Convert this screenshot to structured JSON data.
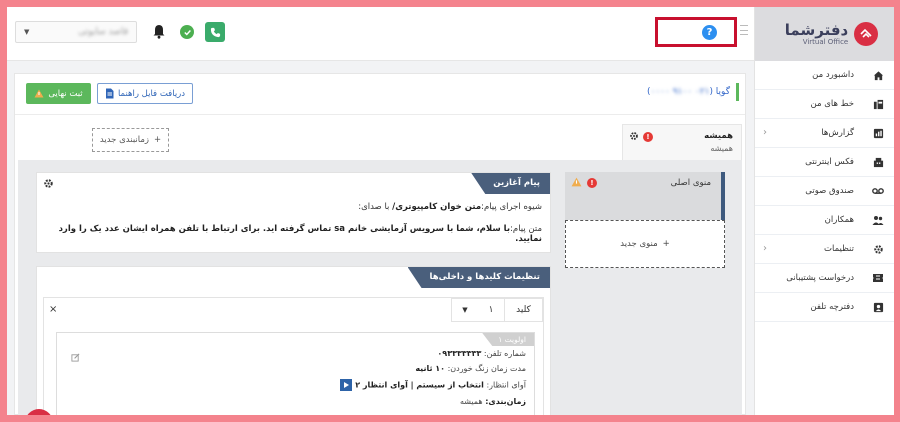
{
  "app": {
    "logo_name": "دفترشما",
    "logo_sub": "Virtual Office",
    "brand_color": "#d92f44"
  },
  "sidebar": {
    "items": [
      {
        "label": "داشبورد من",
        "icon": "home-icon",
        "has_children": false
      },
      {
        "label": "خط های من",
        "icon": "phone-lines-icon",
        "has_children": false
      },
      {
        "label": "گزارش‌ها",
        "icon": "reports-icon",
        "has_children": true
      },
      {
        "label": "فکس اینترنتی",
        "icon": "fax-icon",
        "has_children": false
      },
      {
        "label": "صندوق صوتی",
        "icon": "voicemail-icon",
        "has_children": false
      },
      {
        "label": "همکاران",
        "icon": "users-icon",
        "has_children": false
      },
      {
        "label": "تنظیمات",
        "icon": "gear-icon",
        "has_children": true
      },
      {
        "label": "درخواست پشتیبانی",
        "icon": "ticket-icon",
        "has_children": false
      },
      {
        "label": "دفترچه تلفن",
        "icon": "contacts-icon",
        "has_children": false
      }
    ]
  },
  "topbar": {
    "help_icon": "question-icon",
    "help_symbol": "?",
    "company_select": "قاصد سایوتی"
  },
  "panel": {
    "number_title": "گویا (",
    "number_masked": "۰۲۱ ۹۱۰۰ ۰۰۰۰",
    "number_close": ")",
    "final_button": "ثبت نهایی",
    "guide_button": "دریافت فایل راهنما",
    "tab_title": "همیشه",
    "tab_sub": "همیشه",
    "error_mark": "!",
    "schedule_button": "زمانبندی جدید"
  },
  "menus": {
    "main_label": "منوی اصلی",
    "new_menu_button": "منوی جدید"
  },
  "welcome": {
    "title": "پیام آغازین",
    "mode_label": "شیوه اجرای پیام:",
    "mode_value": "متن خوان کامپیوتری/",
    "mode_suffix": " با صدای:",
    "text_label": "متن پیام:",
    "text_value": "با سلام، شما با سرویس آزمایشی خانم sa تماس گرفته اید. برای ارتباط با تلفن همراه ایشان عدد یک را وارد نمایید."
  },
  "keys": {
    "title": "تنظیمات کلیدها و داخلی‌ها",
    "key_label": "کلید",
    "key_value": "۱",
    "close_symbol": "×",
    "priority_label": "اولویت ۱",
    "phone_label": "شماره تلفن:",
    "phone_value": "۰۹۳۳۳۳۳۳۳",
    "ring_label": "مدت زمان زنگ خوردن:",
    "ring_value": "۱۰ ثانیه",
    "wait_label": "آوای انتظار:",
    "wait_value": "انتخاب از سیستم | آوای انتظار ۲",
    "schedule_label": "زمان‌بندی:",
    "schedule_value": "همیشه"
  },
  "colors": {
    "accent": "#4a5f7c",
    "success": "#5cb85c",
    "danger": "#e53935",
    "highlight": "#c8102e",
    "link": "#3367c9"
  }
}
